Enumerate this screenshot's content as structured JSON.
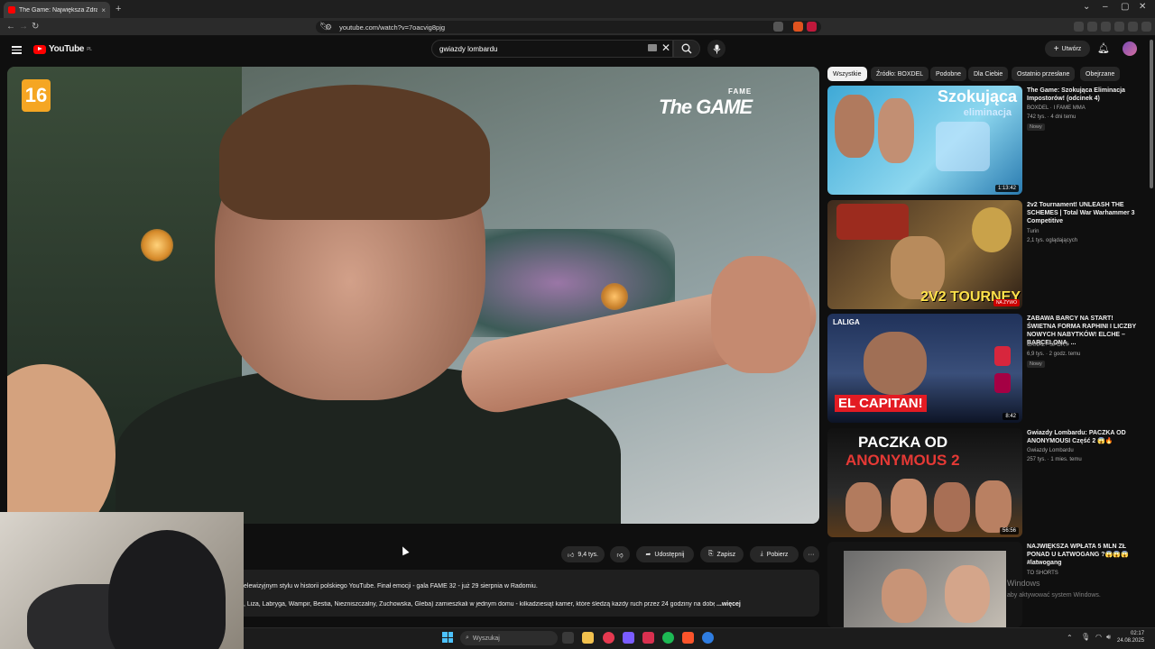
{
  "browser": {
    "tab_title": "The Game: Największa Zdrad",
    "tab_close": "×",
    "new_tab": "+",
    "url": "youtube.com/watch?v=7oacvig8pjg"
  },
  "youtube": {
    "logo_text": "YouTube",
    "logo_region": "PL",
    "search_value": "gwiazdy lombardu",
    "create_label": "Utwórz"
  },
  "video": {
    "age_rating": "16",
    "brand_top": "FAME",
    "brand_main": "The GAME"
  },
  "actions": {
    "likes": "9,4 tys.",
    "share": "Udostępnij",
    "save": "Zapisz",
    "download": "Pobierz",
    "more": "···"
  },
  "description": {
    "line1": "elewizyjnym stylu w historii polskiego YouTube. Finał emocji - gala FAME 32 - już 29 sierpnia w Radomiu.",
    "line2": ", Liza, Labryga, Wampir, Bestia, Niezniszczalny, Żuchowska, Gleba) zamieszkali w jednym domu - kilkadziesiąt kamer, które śledzą każdy ruch przez 24 godziny na dobę",
    "more": "...więcej"
  },
  "chips": [
    "Wszystkie",
    "Źródło: BOXDEL",
    "Podobne",
    "Dla Ciebie",
    "Ostatnio przesłane",
    "Obejrzane"
  ],
  "related": [
    {
      "title": "The Game: Szokująca Eliminacja Impostorów! (odcinek 4)",
      "channel": "BOXDEL · I FAME MMA",
      "meta": "742 tys. · 4 dni temu",
      "badge": "Nowy",
      "duration": "1:13:42",
      "overlay": "Szokująca",
      "overlay2": "eliminacja"
    },
    {
      "title": "2v2 Tournament! UNLEASH THE SCHEMES | Total War Warhammer 3 Competitive",
      "channel": "Turin",
      "meta": "2,1 tys. oglądających",
      "badge": "",
      "duration": "",
      "overlay": "2V2 TOURNEY",
      "overlay2": "NA ŻYWO"
    },
    {
      "title": "ZABAWA BARCY NA START! ŚWIETNA FORMA RAPHINI I LICZBY NOWYCH NABYTKÓW! ELCHE – BARCELONA, ...",
      "channel": "CANAL+ SPORT",
      "meta": "6,9 tys. · 2 godz. temu",
      "badge": "Nowy",
      "duration": "8:42",
      "overlay": "EL CAPITAN!",
      "overlay2": "LALIGA"
    },
    {
      "title": "Gwiazdy Lombardu: PACZKA OD ANONYMOUSI Część 2 😱🔥",
      "channel": "Gwiazdy Lombardu",
      "meta": "257 tys. · 1 mies. temu",
      "badge": "",
      "duration": "56:56",
      "overlay": "PACZKA OD",
      "overlay2": "ANONYMOUS 2"
    },
    {
      "title": "NAJWIĘKSZA WPŁATA 5 MLN ZŁ PONAD U ŁATWOGANG ?😱😱😱 #latwogang",
      "channel": "TO SHORTS",
      "meta": "",
      "badge": "",
      "duration": "",
      "overlay": "",
      "overlay2": ""
    }
  ],
  "windows": {
    "search_placeholder": "Wyszukaj",
    "activate_line1": "Windows",
    "activate_line2": "aby aktywować system Windows.",
    "time": "02:17",
    "date": "24.08.2025"
  },
  "colors": {
    "yt_red": "#ff0000",
    "background": "#0f0f0f",
    "chip_bg": "#272727"
  }
}
